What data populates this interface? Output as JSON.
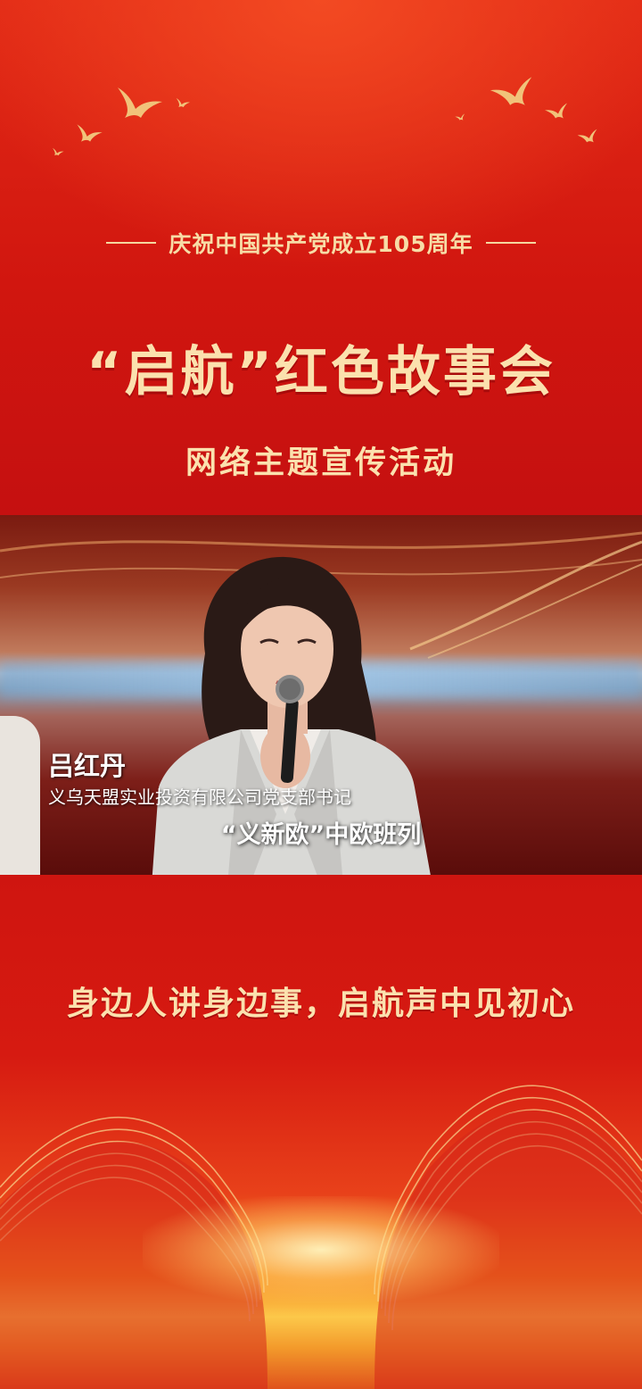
{
  "header": {
    "subtitle": "庆祝中国共产党成立105周年",
    "main_title": "“启航”红色故事会",
    "sub_title": "网络主题宣传活动"
  },
  "video": {
    "name": "吕红丹",
    "role": "义乌天盟实业投资有限公司党支部书记",
    "subtitle": "“义新欧”中欧班列"
  },
  "footer": {
    "slogan": "身边人讲身边事，启航声中见初心"
  },
  "colors": {
    "primary_red": "#d1160f",
    "gold_text": "#fbe1ae"
  }
}
